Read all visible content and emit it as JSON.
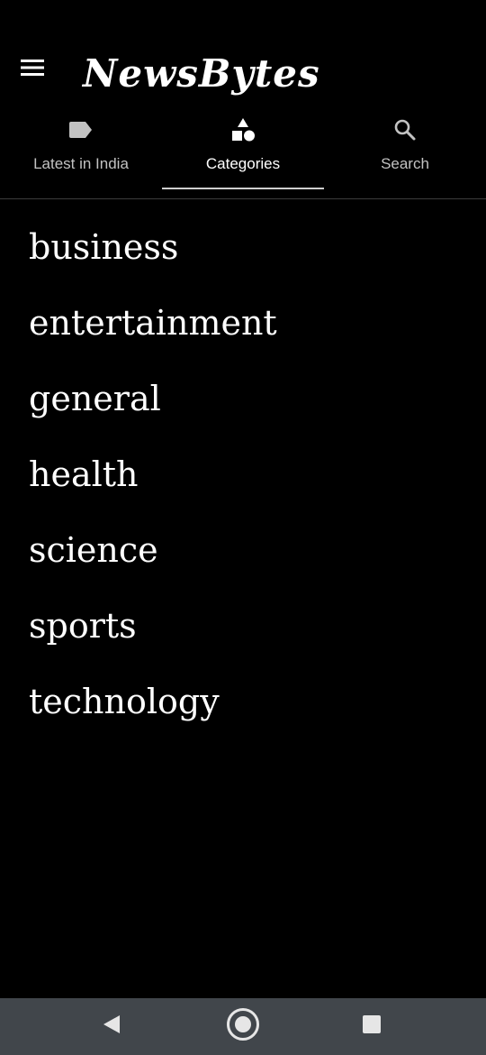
{
  "app": {
    "title": "NewsBytes"
  },
  "header": {
    "menu_icon": "hamburger-menu-icon"
  },
  "tabs": [
    {
      "label": "Latest in India",
      "icon": "label-tag-icon",
      "active": false
    },
    {
      "label": "Categories",
      "icon": "shapes-icon",
      "active": true
    },
    {
      "label": "Search",
      "icon": "search-icon",
      "active": false
    }
  ],
  "categories": [
    "business",
    "entertainment",
    "general",
    "health",
    "science",
    "sports",
    "technology"
  ],
  "system_nav": {
    "buttons": [
      "back-icon",
      "home-icon",
      "recents-icon"
    ]
  },
  "colors": {
    "background": "#000000",
    "text": "#ffffff",
    "inactive_tab": "#c2c2c2",
    "nav_bar": "#41464b",
    "nav_icon": "#e6e6e6"
  }
}
